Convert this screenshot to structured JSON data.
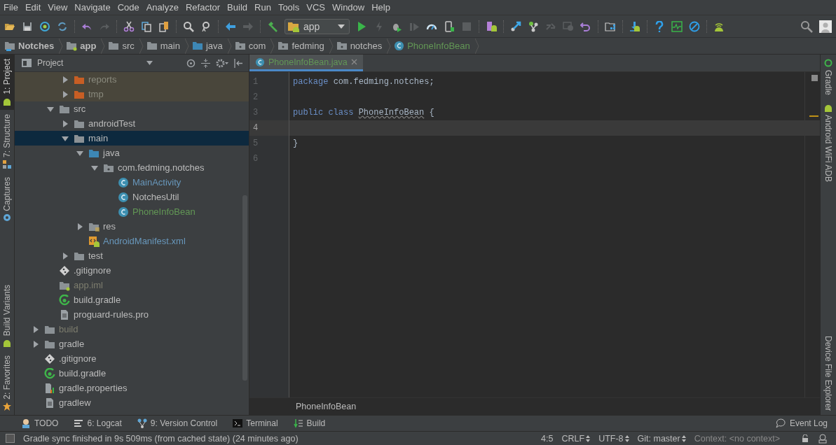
{
  "menu": [
    "File",
    "Edit",
    "View",
    "Navigate",
    "Code",
    "Analyze",
    "Refactor",
    "Build",
    "Run",
    "Tools",
    "VCS",
    "Window",
    "Help"
  ],
  "run_config": {
    "label": "app"
  },
  "breadcrumbs": [
    {
      "label": "Notches",
      "kind": "project"
    },
    {
      "label": "app",
      "kind": "module"
    },
    {
      "label": "src",
      "kind": "folder"
    },
    {
      "label": "main",
      "kind": "folder"
    },
    {
      "label": "java",
      "kind": "source"
    },
    {
      "label": "com",
      "kind": "package"
    },
    {
      "label": "fedming",
      "kind": "package"
    },
    {
      "label": "notches",
      "kind": "package"
    },
    {
      "label": "PhoneInfoBean",
      "kind": "class"
    }
  ],
  "left_tools": [
    {
      "label": "1: Project",
      "selected": true,
      "kind": "android"
    },
    {
      "label": "7: Structure",
      "selected": false,
      "kind": "structure"
    },
    {
      "label": "Captures",
      "selected": false,
      "kind": "captures"
    },
    {
      "label": "Build Variants",
      "selected": false,
      "kind": "android"
    },
    {
      "label": "2: Favorites",
      "selected": false,
      "kind": "star"
    }
  ],
  "project_panel": {
    "title": "Project"
  },
  "tree": [
    {
      "children": [
        {
          "children": [
            {
              "children": [
                {
                  "label": "reports",
                  "kind": "folder",
                  "expanded": false,
                  "excluded": true,
                  "color": "#8a8a7e",
                  "selected": false
                },
                {
                  "label": "tmp",
                  "kind": "folder",
                  "expanded": false,
                  "excluded": true,
                  "color": "#8a8a7e",
                  "selected": false
                }
              ]
            },
            {
              "label": "src",
              "kind": "folder",
              "expanded": true,
              "excluded": false,
              "color": "#bbbbbb",
              "selected": false,
              "children": [
                {
                  "label": "androidTest",
                  "kind": "folder",
                  "expanded": false,
                  "excluded": false,
                  "color": "#bbbbbb",
                  "selected": false
                },
                {
                  "label": "main",
                  "kind": "folder",
                  "expanded": true,
                  "excluded": false,
                  "color": "#bbbbbb",
                  "selected": true,
                  "children": [
                    {
                      "label": "java",
                      "kind": "source",
                      "expanded": true,
                      "excluded": false,
                      "color": "#bbbbbb",
                      "selected": false,
                      "children": [
                        {
                          "label": "com.fedming.notches",
                          "kind": "package",
                          "expanded": true,
                          "excluded": false,
                          "color": "#bbbbbb",
                          "selected": false,
                          "children": [
                            {
                              "label": "MainActivity",
                              "kind": "class",
                              "excluded": false,
                              "color": "#6897bb",
                              "selected": false
                            },
                            {
                              "label": "NotchesUtil",
                              "kind": "class",
                              "excluded": false,
                              "color": "#bbbbbb",
                              "selected": false
                            },
                            {
                              "label": "PhoneInfoBean",
                              "kind": "class",
                              "excluded": false,
                              "color": "#629755",
                              "selected": false
                            }
                          ]
                        }
                      ]
                    },
                    {
                      "label": "res",
                      "kind": "res",
                      "expanded": false,
                      "excluded": false,
                      "color": "#bbbbbb",
                      "selected": false
                    },
                    {
                      "label": "AndroidManifest.xml",
                      "kind": "manifest",
                      "excluded": false,
                      "color": "#6897bb",
                      "selected": false
                    }
                  ]
                },
                {
                  "label": "test",
                  "kind": "folder",
                  "expanded": false,
                  "excluded": false,
                  "color": "#bbbbbb",
                  "selected": false
                }
              ]
            },
            {
              "label": ".gitignore",
              "kind": "git",
              "excluded": false,
              "color": "#bbbbbb",
              "selected": false
            },
            {
              "label": "app.iml",
              "kind": "iml",
              "excluded": false,
              "color": "#7d7d6e",
              "selected": false
            },
            {
              "label": "build.gradle",
              "kind": "gradle",
              "excluded": false,
              "color": "#bbbbbb",
              "selected": false
            },
            {
              "label": "proguard-rules.pro",
              "kind": "file",
              "excluded": false,
              "color": "#bbbbbb",
              "selected": false
            }
          ]
        },
        {
          "label": "build",
          "kind": "folder",
          "expanded": false,
          "excluded": false,
          "color": "#7d7d6e",
          "selected": false
        },
        {
          "label": "gradle",
          "kind": "folder",
          "expanded": false,
          "excluded": false,
          "color": "#bbbbbb",
          "selected": false
        },
        {
          "label": ".gitignore",
          "kind": "git",
          "excluded": false,
          "color": "#bbbbbb",
          "selected": false
        },
        {
          "label": "build.gradle",
          "kind": "gradle",
          "excluded": false,
          "color": "#bbbbbb",
          "selected": false
        },
        {
          "label": "gradle.properties",
          "kind": "properties",
          "excluded": false,
          "color": "#bbbbbb",
          "selected": false
        },
        {
          "label": "gradlew",
          "kind": "file",
          "excluded": false,
          "color": "#bbbbbb",
          "selected": false
        }
      ]
    }
  ],
  "editor_tabs": [
    {
      "label": "PhoneInfoBean.java",
      "selected": true
    }
  ],
  "code_lines": [
    {
      "number": "1",
      "current": false,
      "tokens": [
        {
          "text": "package",
          "kind": "keyword"
        },
        {
          "text": "com.fedming.notches;",
          "kind": "plain"
        }
      ]
    },
    {
      "number": "2",
      "current": false
    },
    {
      "number": "3",
      "current": false,
      "tokens": [
        {
          "text": "public class",
          "kind": "keyword"
        },
        {
          "text": "PhoneInfoBean",
          "kind": "typo"
        },
        {
          "text": "{",
          "kind": "plain"
        }
      ]
    },
    {
      "number": "4",
      "current": true
    },
    {
      "number": "5",
      "current": false,
      "tokens": [
        {
          "text": "}",
          "kind": "plain"
        }
      ]
    },
    {
      "number": "6",
      "current": false
    }
  ],
  "editor_breadcrumb": "PhoneInfoBean",
  "right_tools": [
    {
      "label": "Gradle",
      "kind": "gradle"
    },
    {
      "label": "Android WiFi ADB",
      "kind": "android"
    },
    {
      "label": "Device File Explorer",
      "kind": "none"
    }
  ],
  "bottom_tools": [
    {
      "label": "TODO",
      "kind": "todo"
    },
    {
      "label": "6: Logcat",
      "kind": "logcat"
    },
    {
      "label": "9: Version Control",
      "kind": "vcs"
    },
    {
      "label": "Terminal",
      "kind": "terminal"
    },
    {
      "label": "Build",
      "kind": "build"
    }
  ],
  "event_log": "Event Log",
  "status": {
    "message": "Gradle sync finished in 9s 509ms (from cached state) (24 minutes ago)",
    "position": "4:5",
    "line_separator": "CRLF",
    "encoding": "UTF-8",
    "vcs": "Git: master",
    "context": "Context: <no context>"
  }
}
